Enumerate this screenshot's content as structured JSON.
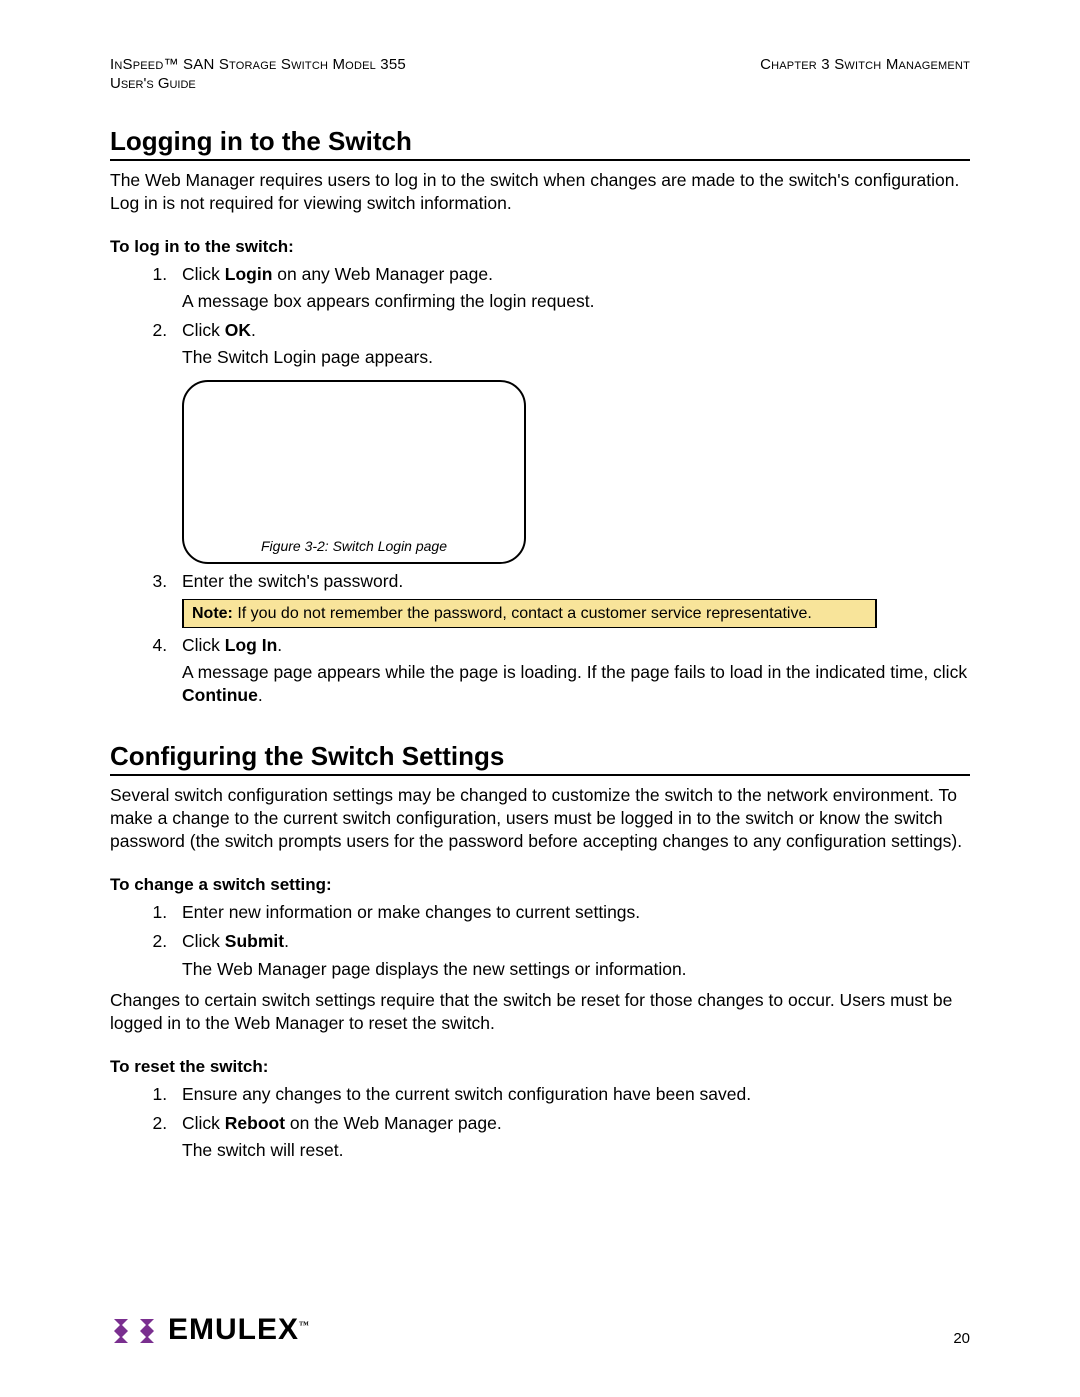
{
  "header": {
    "product_left": "InSpeed™ SAN Storage Switch Model 355",
    "subtitle_left": "User's Guide",
    "chapter_right": "Chapter 3 Switch Management"
  },
  "section1": {
    "title": "Logging in to the Switch",
    "intro": "The Web Manager requires users to log in to the switch when changes are made to the switch's configuration. Log in is not required for viewing switch information.",
    "subhead": "To log in to the switch:",
    "step1_a": "Click ",
    "step1_bold": "Login",
    "step1_b": " on any Web Manager page.",
    "step1_cont": "A message box appears confirming the login request.",
    "step2_a": "Click ",
    "step2_bold": "OK",
    "step2_b": ".",
    "step2_cont": "The Switch Login page appears.",
    "figure_caption": "Figure 3-2: Switch Login page",
    "step3": "Enter the switch's password.",
    "note_label": "Note:",
    "note_text": " If you do not remember the password, contact a customer service representative.",
    "step4_a": "Click ",
    "step4_bold": "Log In",
    "step4_b": ".",
    "step4_cont_a": "A message page appears while the page is loading. If the page fails to load in the indicated time, click ",
    "step4_cont_bold": "Continue",
    "step4_cont_b": "."
  },
  "section2": {
    "title": "Configuring the Switch Settings",
    "intro": "Several switch configuration settings may be changed to customize the switch to the network environment. To make a change to the current switch configuration, users must be logged in to the switch or know the switch password (the switch prompts users for the password before accepting changes to any configuration settings).",
    "subhead1": "To change a switch setting:",
    "s1_step1": "Enter new information or make changes to current settings.",
    "s1_step2_a": "Click ",
    "s1_step2_bold": "Submit",
    "s1_step2_b": ".",
    "s1_step2_cont": "The Web Manager page displays the new settings or information.",
    "para2": "Changes to certain switch settings require that the switch be reset for those changes to occur. Users must be logged in to the Web Manager to reset the switch.",
    "subhead2": "To reset the switch:",
    "s2_step1": "Ensure any changes to the current switch configuration have been saved.",
    "s2_step2_a": "Click ",
    "s2_step2_bold": "Reboot",
    "s2_step2_b": " on the Web Manager page.",
    "s2_step2_cont": "The switch will reset."
  },
  "footer": {
    "brand": "EMULEX",
    "tm": "™",
    "page": "20"
  }
}
